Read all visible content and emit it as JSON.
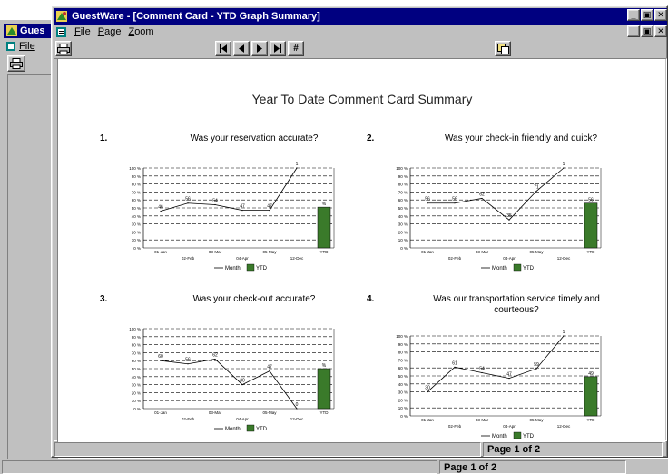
{
  "background_window": {
    "title": "Gues",
    "menu": [
      "File"
    ]
  },
  "window": {
    "title": "GuestWare - [Comment Card - YTD Graph Summary]",
    "controls": [
      "minimize",
      "restore",
      "close"
    ]
  },
  "menu": [
    {
      "label": "File",
      "accel": "F"
    },
    {
      "label": "Page",
      "accel": "P"
    },
    {
      "label": "Zoom",
      "accel": "Z"
    }
  ],
  "toolbar": {
    "print_icon": "printer-icon",
    "nav": [
      {
        "name": "first-page-button",
        "icon": "first-page-icon"
      },
      {
        "name": "previous-page-button",
        "icon": "previous-page-icon"
      },
      {
        "name": "next-page-button",
        "icon": "next-page-icon"
      },
      {
        "name": "last-page-button",
        "icon": "last-page-icon"
      },
      {
        "name": "goto-page-button",
        "icon": "hash-icon"
      }
    ],
    "copy_icon": "copy-icon"
  },
  "report": {
    "title": "Year To Date Comment Card Summary"
  },
  "legend": {
    "month": "Month",
    "ytd": "YTD"
  },
  "colors": {
    "ytd_bar": "#3a7a2a",
    "titlebar": "#000080"
  },
  "chart_data": [
    {
      "type": "line",
      "number": "1.",
      "title": "Was your reservation accurate?",
      "categories": [
        "01-Jan",
        "02-Feb",
        "03-Mar",
        "04-Apr",
        "05-May",
        "12-Dec"
      ],
      "values": [
        46,
        56,
        54,
        47,
        47,
        100
      ],
      "labels": [
        "46",
        "56",
        "54",
        "47",
        "47",
        "1"
      ],
      "ytd": {
        "category": "YTD",
        "value": 51,
        "label": "%"
      },
      "y_ticks": [
        "0 %",
        "10 %",
        "20 %",
        "30 %",
        "40 %",
        "50 %",
        "60 %",
        "70 %",
        "80 %",
        "90 %",
        "100 %"
      ],
      "ylim": [
        0,
        100
      ],
      "grid": true
    },
    {
      "type": "line",
      "number": "2.",
      "title": "Was your check-in friendly and quick?",
      "categories": [
        "01-Jan",
        "02-Feb",
        "03-Mar",
        "04-Apr",
        "05-May",
        "12-Dec"
      ],
      "values": [
        56,
        56,
        62,
        35,
        71,
        100
      ],
      "labels": [
        "56",
        "56",
        "62",
        "35",
        "71",
        "1"
      ],
      "ytd": {
        "category": "YTD",
        "value": 56,
        "label": "56"
      },
      "y_ticks": [
        "0 %",
        "10 %",
        "20 %",
        "30 %",
        "40 %",
        "50 %",
        "60 %",
        "70 %",
        "80 %",
        "90 %",
        "100 %"
      ],
      "ylim": [
        0,
        100
      ],
      "grid": true
    },
    {
      "type": "line",
      "number": "3.",
      "title": "Was your check-out accurate?",
      "categories": [
        "01-Jan",
        "02-Feb",
        "03-Mar",
        "04-Apr",
        "05-May",
        "12-Dec"
      ],
      "values": [
        60,
        56,
        62,
        30,
        47,
        0
      ],
      "labels": [
        "60",
        "56",
        "62",
        "30",
        "47",
        "0"
      ],
      "ytd": {
        "category": "YTD",
        "value": 50,
        "label": "%"
      },
      "y_ticks": [
        "0 %",
        "10 %",
        "20 %",
        "30 %",
        "40 %",
        "50 %",
        "60 %",
        "70 %",
        "80 %",
        "90 %",
        "100 %"
      ],
      "ylim": [
        0,
        100
      ],
      "grid": true
    },
    {
      "type": "line",
      "number": "4.",
      "title": "Was our transportation service timely and courteous?",
      "categories": [
        "01-Jan",
        "02-Feb",
        "03-Mar",
        "04-Apr",
        "05-May",
        "12-Dec"
      ],
      "values": [
        30,
        61,
        54,
        47,
        59,
        100
      ],
      "labels": [
        "30",
        "61",
        "54",
        "47",
        "59",
        "1"
      ],
      "ytd": {
        "category": "YTD",
        "value": 49,
        "label": "49"
      },
      "y_ticks": [
        "0 %",
        "10 %",
        "20 %",
        "30 %",
        "40 %",
        "50 %",
        "60 %",
        "70 %",
        "80 %",
        "90 %",
        "100 %"
      ],
      "ylim": [
        0,
        100
      ],
      "grid": true
    }
  ],
  "status": {
    "page_indicator": "Page 1 of 2",
    "outer_page_indicator": "Page 1 of 2"
  }
}
